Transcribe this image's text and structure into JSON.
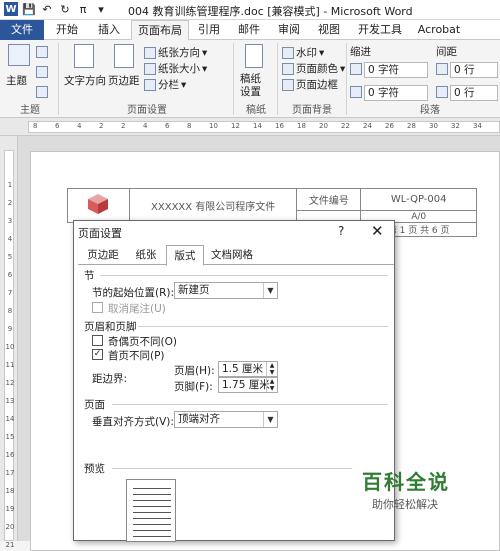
{
  "window": {
    "title": "004 教育训练管理程序.doc [兼容模式] - Microsoft Word",
    "app_logo": "W"
  },
  "ribbon_tabs": [
    {
      "label": "文件"
    },
    {
      "label": "开始"
    },
    {
      "label": "插入"
    },
    {
      "label": "页面布局"
    },
    {
      "label": "引用"
    },
    {
      "label": "邮件"
    },
    {
      "label": "审阅"
    },
    {
      "label": "视图"
    },
    {
      "label": "开发工具"
    },
    {
      "label": "Acrobat"
    }
  ],
  "ribbon": {
    "theme_group": {
      "theme_label": "主题",
      "group_label": "主题"
    },
    "page_setup": {
      "text_direction": "文字方向",
      "margins": "页边距",
      "orientation": "纸张方向",
      "size": "纸张大小",
      "columns": "分栏",
      "group_label": "页面设置"
    },
    "draft": {
      "label": "稿纸\n设置",
      "group_label": "稿纸"
    },
    "page_bg": {
      "watermark": "水印",
      "page_color": "页面颜色",
      "page_border": "页面边框",
      "group_label": "页面背景"
    },
    "paragraph": {
      "indent_label": "缩进",
      "spacing_label": "间距",
      "indent_left": "0 字符",
      "indent_right": "0 字符",
      "spacing_before": "0 行",
      "spacing_after": "0 行",
      "group_label": "段落"
    }
  },
  "ruler": {
    "h_numbers": [
      "8",
      "6",
      "4",
      "2",
      "2",
      "4",
      "6",
      "8",
      "10",
      "12",
      "14",
      "16",
      "18",
      "20",
      "22",
      "24",
      "26",
      "28",
      "30",
      "32",
      "34"
    ],
    "v_numbers": [
      "1",
      "2",
      "3",
      "4",
      "5",
      "6",
      "7",
      "8",
      "9",
      "10",
      "11",
      "12",
      "13",
      "14",
      "15",
      "16",
      "17",
      "18",
      "19",
      "20",
      "21"
    ]
  },
  "document": {
    "company_cell": "XXXXXX 有限公司程序文件",
    "doc_no_label": "文件编号",
    "doc_no_value": "WL-QP-004",
    "version": "A/0",
    "page_info": "第 1 页 共 6 页"
  },
  "dialog": {
    "title": "页面设置",
    "help": "?",
    "close": "✕",
    "tabs": [
      "页边距",
      "纸张",
      "版式",
      "文档网格"
    ],
    "section": {
      "heading": "节",
      "start_label": "节的起始位置(R):",
      "start_value": "新建页",
      "suppress_endnotes": "取消尾注(U)"
    },
    "headers_footers": {
      "heading": "页眉和页脚",
      "odd_even": "奇偶页不同(O)",
      "first_page": "首页不同(P)",
      "from_edge": "距边界:",
      "header_label": "页眉(H):",
      "header_value": "1.5 厘米",
      "footer_label": "页脚(F):",
      "footer_value": "1.75 厘米"
    },
    "page": {
      "heading": "页面",
      "valign_label": "垂直对齐方式(V):",
      "valign_value": "顶端对齐"
    },
    "preview": {
      "heading": "预览"
    }
  },
  "watermark": {
    "title": "百科全说",
    "subtitle": "助你轻松解决"
  }
}
